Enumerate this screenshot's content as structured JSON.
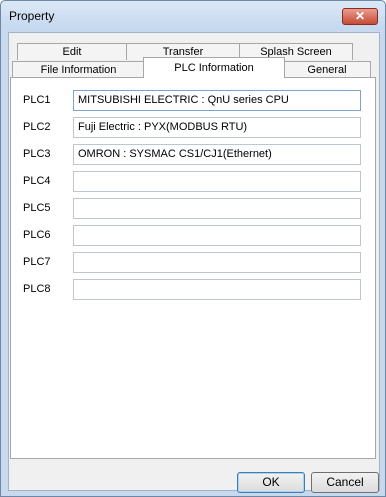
{
  "window": {
    "title": "Property",
    "close_glyph": "✕"
  },
  "tabs_row1": [
    {
      "label": "Edit"
    },
    {
      "label": "Transfer"
    },
    {
      "label": "Splash Screen"
    }
  ],
  "tabs_row2": [
    {
      "label": "File Information"
    },
    {
      "label": "PLC Information",
      "selected": true
    },
    {
      "label": "General"
    }
  ],
  "plc_fields": [
    {
      "label": "PLC1",
      "value": "MITSUBISHI ELECTRIC : QnU series CPU"
    },
    {
      "label": "PLC2",
      "value": "Fuji Electric : PYX(MODBUS RTU)"
    },
    {
      "label": "PLC3",
      "value": "OMRON : SYSMAC CS1/CJ1(Ethernet)"
    },
    {
      "label": "PLC4",
      "value": ""
    },
    {
      "label": "PLC5",
      "value": ""
    },
    {
      "label": "PLC6",
      "value": ""
    },
    {
      "label": "PLC7",
      "value": ""
    },
    {
      "label": "PLC8",
      "value": ""
    }
  ],
  "buttons": {
    "ok": "OK",
    "cancel": "Cancel"
  }
}
